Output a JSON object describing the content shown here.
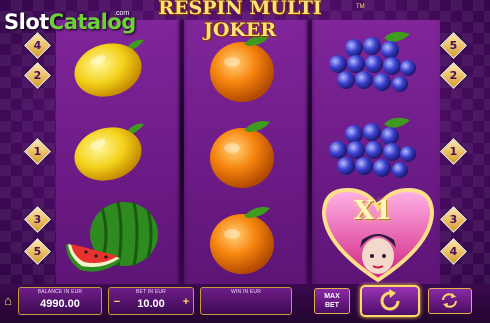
{
  "watermark": {
    "part1": "Slot",
    "part2": "Catalog",
    "suffix": ".com"
  },
  "game": {
    "title": "RESPIN MULTI JOKER",
    "trademark": "TM"
  },
  "paylines": {
    "left": [
      "4",
      "2",
      "1",
      "3",
      "5"
    ],
    "right": [
      "5",
      "2",
      "1",
      "3",
      "4"
    ]
  },
  "reels": [
    [
      "lemon",
      "lemon",
      "watermelon"
    ],
    [
      "orange",
      "orange",
      "orange"
    ],
    [
      "grapes",
      "grapes",
      "joker-heart"
    ]
  ],
  "joker": {
    "multiplier": "X1"
  },
  "panel": {
    "balance": {
      "label": "BALANCE IN EUR",
      "value": "4990.00"
    },
    "bet": {
      "label": "BET IN EUR",
      "value": "10.00",
      "decrease": "−",
      "increase": "+"
    },
    "win": {
      "label": "WIN IN EUR",
      "value": ""
    },
    "max_bet": {
      "line1": "MAX",
      "line2": "BET"
    }
  },
  "colors": {
    "accent_gold": "#ffd86a",
    "background_purple": "#4a0c63",
    "watermark_green": "#6fd13a"
  },
  "icons": {
    "home": "home-icon",
    "spin": "spin-arrow-icon",
    "autoplay": "autoplay-icon"
  }
}
